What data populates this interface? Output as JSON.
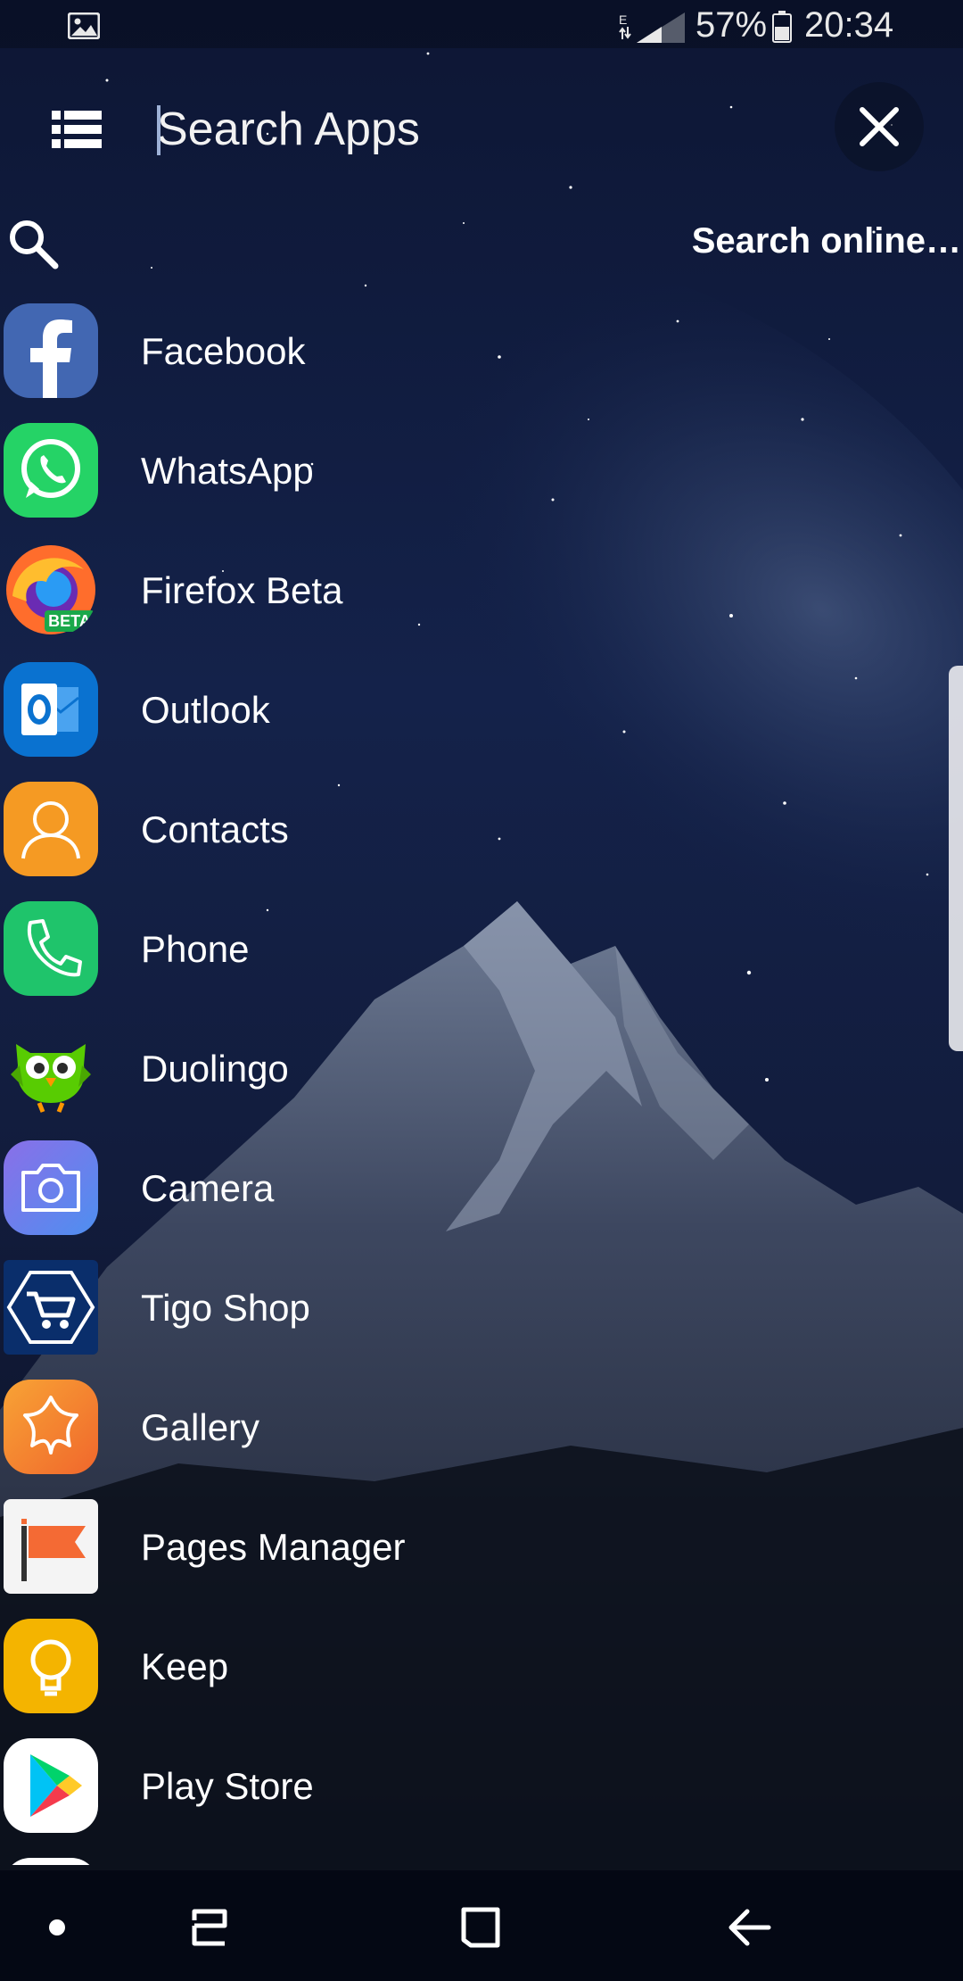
{
  "status_bar": {
    "battery": "57%",
    "time": "20:34",
    "network_type": "E",
    "icons": [
      "image-notification-icon",
      "signal-icon",
      "battery-icon"
    ]
  },
  "search": {
    "placeholder": "Search Apps",
    "value": "",
    "online_label": "Search online…"
  },
  "apps": [
    {
      "label": "Facebook",
      "icon": "facebook-icon",
      "color": "#3b5998"
    },
    {
      "label": "WhatsApp",
      "icon": "whatsapp-icon",
      "color": "#25d366"
    },
    {
      "label": "Firefox Beta",
      "icon": "firefox-beta-icon",
      "color": "#ff6d2c"
    },
    {
      "label": "Outlook",
      "icon": "outlook-icon",
      "color": "#0a72d0"
    },
    {
      "label": "Contacts",
      "icon": "contacts-icon",
      "color": "#f59a23"
    },
    {
      "label": "Phone",
      "icon": "phone-icon",
      "color": "#1fc46b"
    },
    {
      "label": "Duolingo",
      "icon": "duolingo-icon",
      "color": "#58cc02"
    },
    {
      "label": "Camera",
      "icon": "camera-icon",
      "color": "#7b73e6"
    },
    {
      "label": "Tigo Shop",
      "icon": "tigo-shop-icon",
      "color": "#0a2e6b"
    },
    {
      "label": "Gallery",
      "icon": "gallery-icon",
      "color": "#f5882a"
    },
    {
      "label": "Pages Manager",
      "icon": "pages-manager-icon",
      "color": "#f46a34"
    },
    {
      "label": "Keep",
      "icon": "keep-icon",
      "color": "#f4b400"
    },
    {
      "label": "Play Store",
      "icon": "play-store-icon",
      "color": "#ffffff"
    }
  ],
  "nav_bar": {
    "icons": [
      "nav-dot-icon",
      "recent-apps-icon",
      "home-icon",
      "back-icon"
    ]
  }
}
